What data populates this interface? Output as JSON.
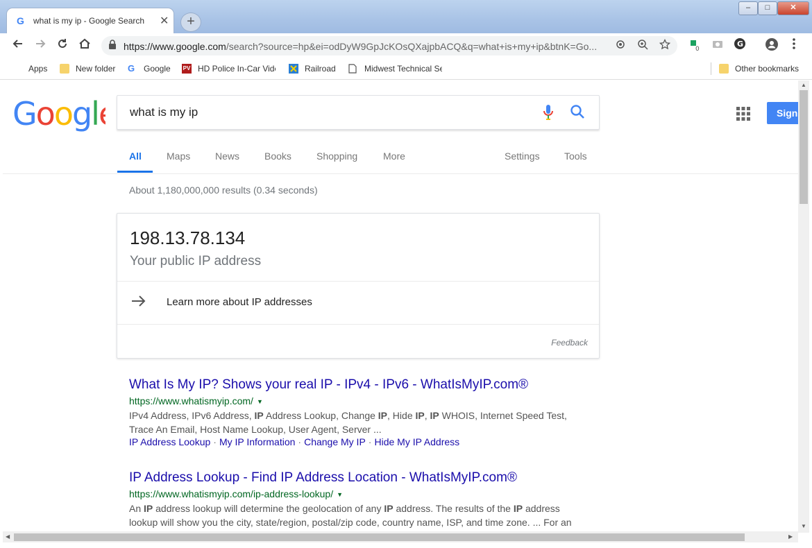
{
  "window": {
    "tab_title": "what is my ip - Google Search",
    "tab_close": "✕",
    "new_tab": "+",
    "min": "–",
    "max": "□",
    "close": "✕"
  },
  "toolbar": {
    "url_host": "https://www.google.com",
    "url_path": "/search?source=hp&ei=odDyW9GpJcKOsQXajpbACQ&q=what+is+my+ip&btnK=Go...",
    "extension_badge": "0"
  },
  "bookmarks": {
    "items": [
      "Apps",
      "New folder",
      "Google",
      "HD Police In-Car Vide",
      "Railroad",
      "Midwest Technical Se"
    ],
    "other": "Other bookmarks"
  },
  "search": {
    "query": "what is my ip",
    "signin": "Sign"
  },
  "tabs": {
    "all": "All",
    "maps": "Maps",
    "news": "News",
    "books": "Books",
    "shopping": "Shopping",
    "more": "More",
    "settings": "Settings",
    "tools": "Tools"
  },
  "stats": "About 1,180,000,000 results (0.34 seconds)",
  "ip_card": {
    "ip": "198.13.78.134",
    "subtitle": "Your public IP address",
    "learn_more": "Learn more about IP addresses",
    "feedback": "Feedback"
  },
  "results": [
    {
      "title": "What Is My IP? Shows your real IP - IPv4 - IPv6 - WhatIsMyIP.com®",
      "url": "https://www.whatismyip.com/",
      "snippet_line1_parts": [
        "IPv4 Address, IPv6 Address, ",
        "IP",
        " Address Lookup, Change ",
        "IP",
        ", Hide ",
        "IP",
        ", ",
        "IP",
        " WHOIS, Internet Speed Test,"
      ],
      "snippet_line2": "Trace An Email, Host Name Lookup, User Agent, Server ...",
      "sitelinks": [
        "IP Address Lookup",
        "My IP Information",
        "Change My IP",
        "Hide My IP Address"
      ]
    },
    {
      "title": "IP Address Lookup - Find IP Address Location - WhatIsMyIP.com®",
      "url": "https://www.whatismyip.com/ip-address-lookup/",
      "snippet_line1_parts": [
        "An ",
        "IP",
        " address lookup will determine the geolocation of any ",
        "IP",
        " address. The results of the ",
        "IP",
        " address"
      ],
      "snippet_line2": "lookup will show you the city, state/region, postal/zip code, country name, ISP, and time zone. ... For an"
    }
  ]
}
